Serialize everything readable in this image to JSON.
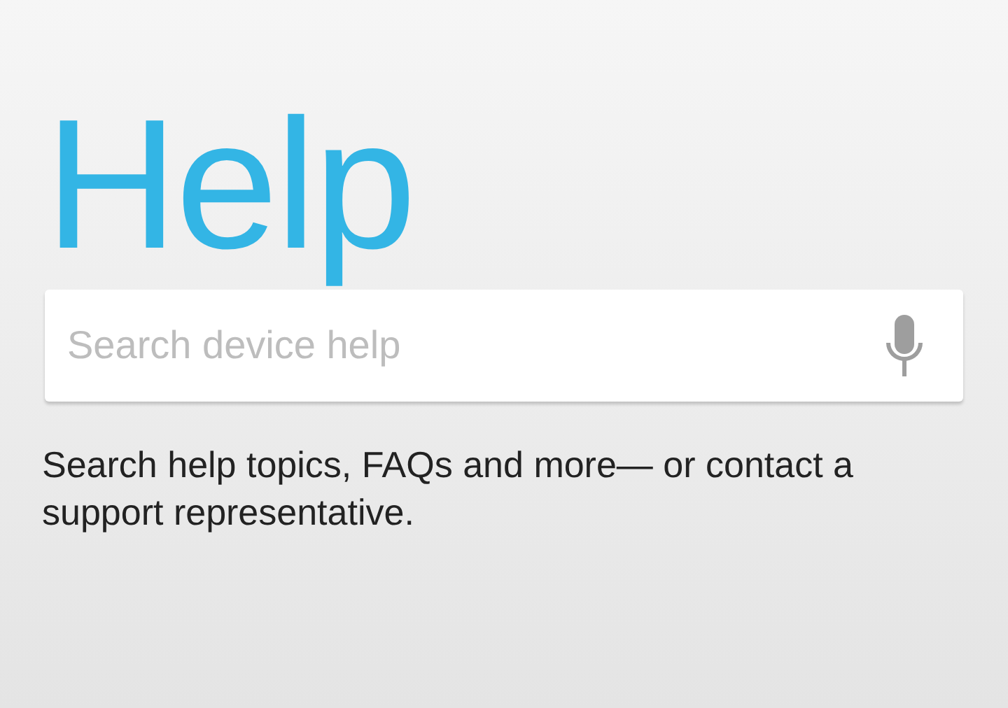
{
  "title": "Help",
  "search": {
    "placeholder": "Search device help"
  },
  "description": "Search help topics, FAQs and more— or contact a support representative."
}
